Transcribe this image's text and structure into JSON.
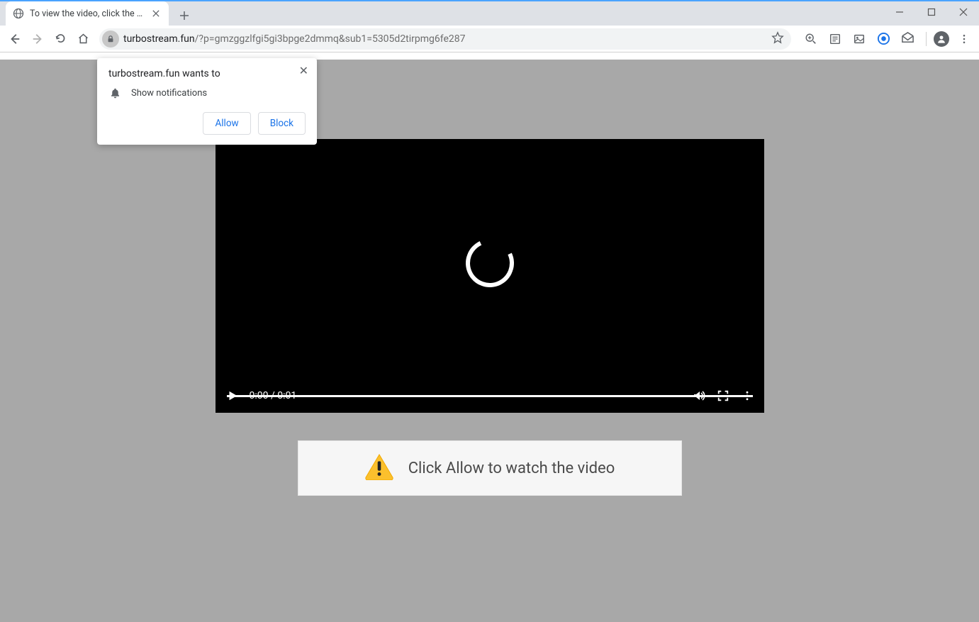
{
  "tab": {
    "title": "To view the video, click the Allow"
  },
  "url": {
    "domain": "turbostream.fun",
    "path": "/?p=gmzggzlfgi5gi3bpge2dmmq&sub1=5305d2tirpmg6fe287"
  },
  "prompt": {
    "title": "turbostream.fun wants to",
    "permission": "Show notifications",
    "allow": "Allow",
    "block": "Block"
  },
  "video": {
    "time": "0:00 / 0:01"
  },
  "banner": {
    "text": "Click Allow to watch the video"
  }
}
